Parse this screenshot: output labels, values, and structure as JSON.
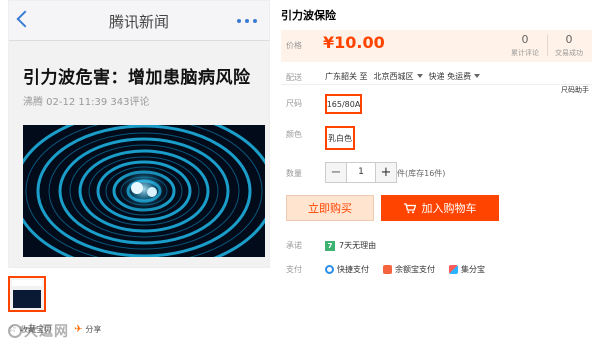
{
  "product_image": {
    "nav_title": "腾讯新闻",
    "article_title": "引力波危害：增加患脑病风险",
    "meta": "沸腾  02-12 11:39  343评论"
  },
  "gallery": {
    "favorite_label": "收藏宝贝",
    "share_label": "分享",
    "watermark": "大逗网"
  },
  "product": {
    "title": "引力波保险",
    "price_label": "价格",
    "price": "¥10.00",
    "reviews_count": "0",
    "reviews_label": "累计评论",
    "sales_count": "0",
    "sales_label": "交易成功"
  },
  "delivery": {
    "label": "配送",
    "from": "广东韶关 至",
    "to": "北京西城区",
    "shipping": "快递 免运费"
  },
  "size_helper": "尺码助手",
  "sku": {
    "size_label": "尺码",
    "size_value": "165/80A",
    "color_label": "颜色",
    "color_value": "乳白色"
  },
  "quantity": {
    "label": "数量",
    "minus": "−",
    "value": "1",
    "plus": "+",
    "stock": "件(库存16件)"
  },
  "actions": {
    "buy_now": "立即购买",
    "add_to_cart": "加入购物车"
  },
  "promise": {
    "label": "承诺",
    "icon_text": "7",
    "text": "7天无理由"
  },
  "payment": {
    "label": "支付",
    "methods": [
      "快捷支付",
      "余额宝支付",
      "集分宝"
    ]
  },
  "colors": {
    "accent": "#ff4400",
    "price_bg": "#fff2e8"
  }
}
